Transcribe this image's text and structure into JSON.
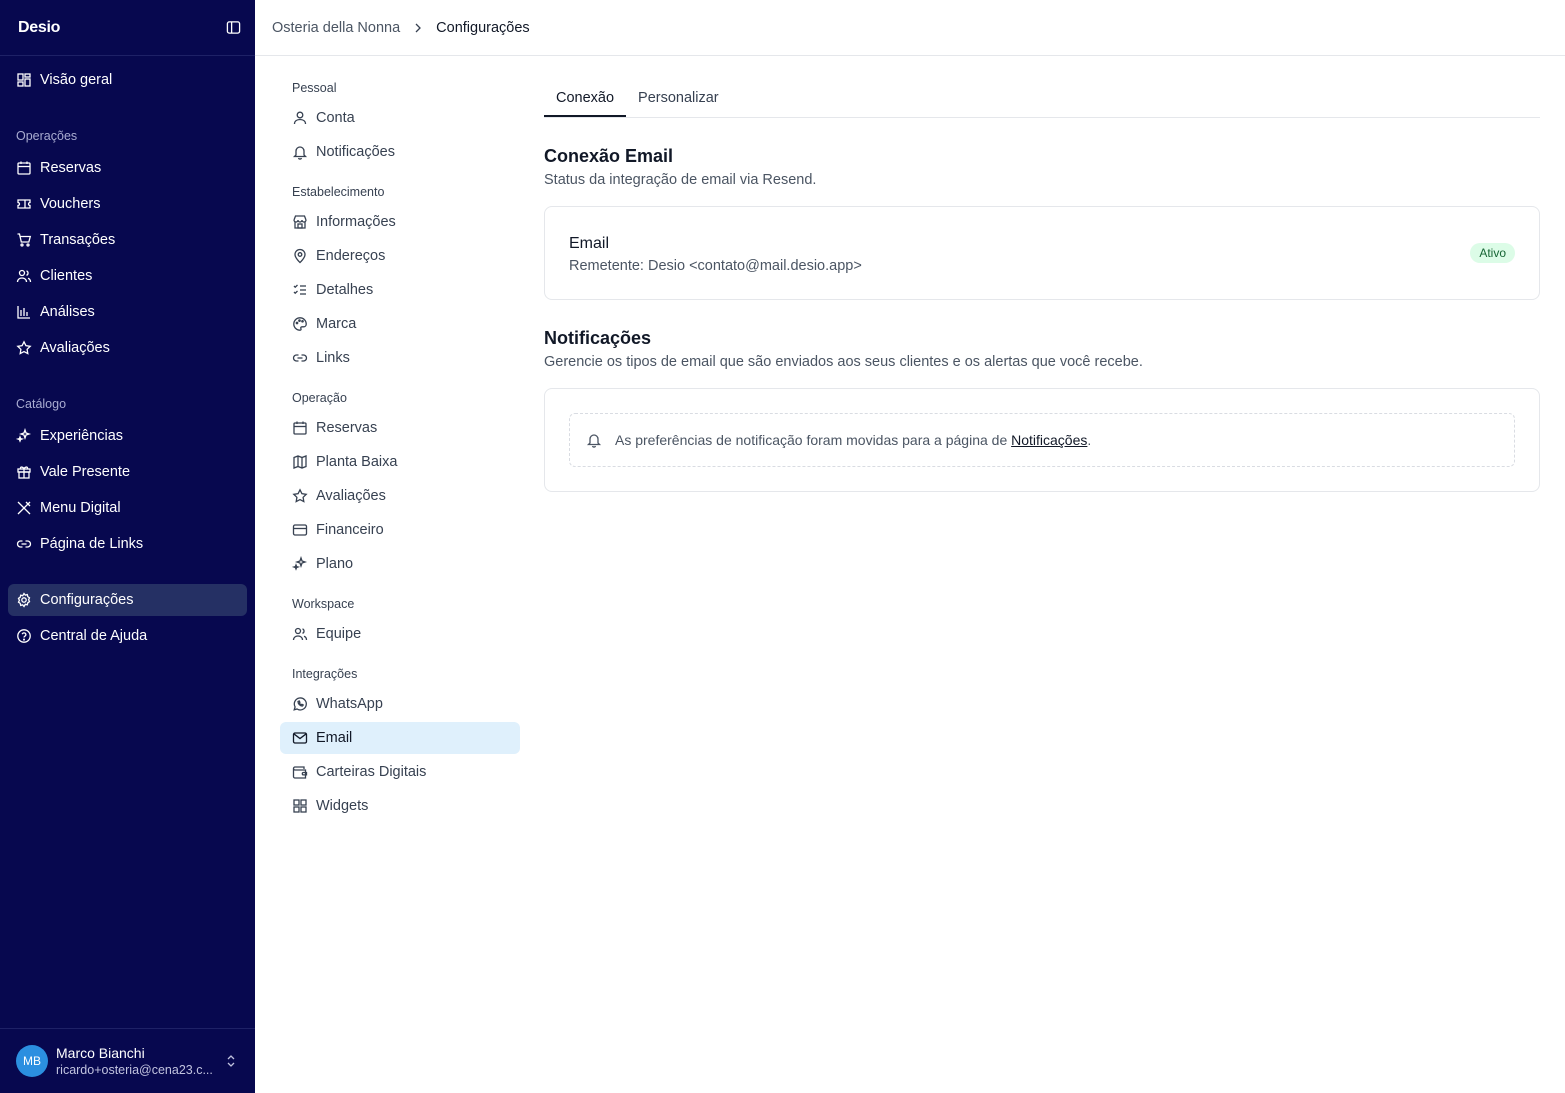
{
  "sidebar": {
    "logo": "Desio",
    "overview": "Visão geral",
    "section_ops": "Operações",
    "ops": [
      "Reservas",
      "Vouchers",
      "Transações",
      "Clientes",
      "Análises",
      "Avaliações"
    ],
    "section_catalog": "Catálogo",
    "catalog": [
      "Experiências",
      "Vale Presente",
      "Menu Digital",
      "Página de Links"
    ],
    "settings": "Configurações",
    "help": "Central de Ajuda",
    "user": {
      "initials": "MB",
      "name": "Marco Bianchi",
      "email": "ricardo+osteria@cena23.c..."
    }
  },
  "breadcrumb": {
    "parent": "Osteria della Nonna",
    "current": "Configurações"
  },
  "subnav": {
    "personal_title": "Pessoal",
    "personal": [
      "Conta",
      "Notificações"
    ],
    "establishment_title": "Estabelecimento",
    "establishment": [
      "Informações",
      "Endereços",
      "Detalhes",
      "Marca",
      "Links"
    ],
    "operation_title": "Operação",
    "operation": [
      "Reservas",
      "Planta Baixa",
      "Avaliações",
      "Financeiro",
      "Plano"
    ],
    "workspace_title": "Workspace",
    "workspace": [
      "Equipe"
    ],
    "integrations_title": "Integrações",
    "integrations": [
      "WhatsApp",
      "Email",
      "Carteiras Digitais",
      "Widgets"
    ]
  },
  "tabs": [
    "Conexão",
    "Personalizar"
  ],
  "connection": {
    "title": "Conexão Email",
    "description": "Status da integração de email via Resend.",
    "card_title": "Email",
    "sender": "Remetente: Desio <contato@mail.desio.app>",
    "status": "Ativo"
  },
  "notifications": {
    "title": "Notificações",
    "description": "Gerencie os tipos de email que são enviados aos seus clientes e os alertas que você recebe.",
    "notice_text": "As preferências de notificação foram movidas para a página de ",
    "notice_link": "Notificações",
    "notice_end": "."
  },
  "colors": {
    "sidebar_bg": "#07084f",
    "active_subnav": "#dff0fc",
    "badge_bg": "#dcfce7",
    "badge_text": "#166534"
  }
}
